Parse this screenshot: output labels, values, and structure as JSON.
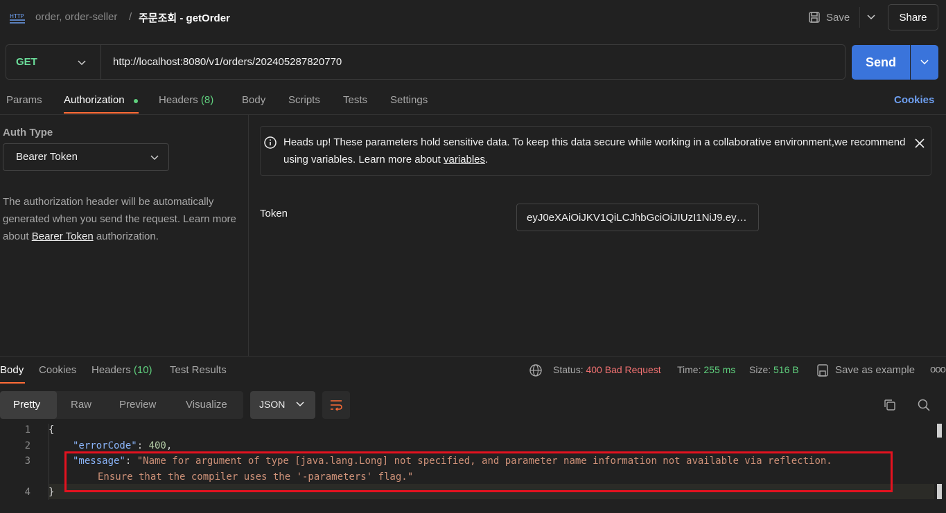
{
  "header": {
    "icon_text": "HTTP",
    "breadcrumb_parent": "order, order-seller",
    "breadcrumb_sep": "/",
    "title": "주문조회 - getOrder",
    "save_label": "Save",
    "share_label": "Share"
  },
  "request": {
    "method": "GET",
    "url": "http://localhost:8080/v1/orders/202405287820770",
    "send_label": "Send"
  },
  "tabs": {
    "params": "Params",
    "authorization": "Authorization",
    "headers": "Headers",
    "headers_count": "(8)",
    "body": "Body",
    "scripts": "Scripts",
    "tests": "Tests",
    "settings": "Settings",
    "cookies": "Cookies"
  },
  "auth": {
    "type_label": "Auth Type",
    "type_value": "Bearer Token",
    "desc_pre": "The authorization header will be automatically generated when you send the request. Learn more about ",
    "desc_link": "Bearer Token",
    "desc_post": " authorization."
  },
  "notice": {
    "text_pre": "Heads up! These parameters hold sensitive data. To keep this data secure while working in a collaborative environment,we recommend using variables. Learn more about ",
    "link": "variables",
    "text_post": "."
  },
  "token": {
    "label": "Token",
    "value": "eyJ0eXAiOiJKV1QiLCJhbGciOiJIUzI1NiJ9.ey…"
  },
  "response": {
    "tab_body": "Body",
    "tab_cookies": "Cookies",
    "tab_headers": "Headers",
    "tab_headers_count": "(10)",
    "tab_tests": "Test Results",
    "status_label": "Status:",
    "status_value": "400 Bad Request",
    "time_label": "Time:",
    "time_value": "255 ms",
    "size_label": "Size:",
    "size_value": "516 B",
    "save_example": "Save as example",
    "more": "ooo"
  },
  "format": {
    "pretty": "Pretty",
    "raw": "Raw",
    "preview": "Preview",
    "visualize": "Visualize",
    "lang": "JSON"
  },
  "code": {
    "line_numbers": [
      "1",
      "2",
      "3",
      "4"
    ],
    "open_brace": "{",
    "close_brace": "}",
    "key_error": "\"errorCode\"",
    "val_error": "400",
    "key_message": "\"message\"",
    "val_message_1": "\"Name for argument of type [java.lang.Long] not specified, and parameter name information not available via reflection.",
    "val_message_2": "Ensure that the compiler uses the '-parameters' flag.\""
  },
  "colors": {
    "accent": "#ff6c37",
    "send": "#3a74db",
    "method": "#6bdd9a",
    "error": "#f07171",
    "success": "#5fcf7d",
    "highlight_box": "#e4121f"
  }
}
